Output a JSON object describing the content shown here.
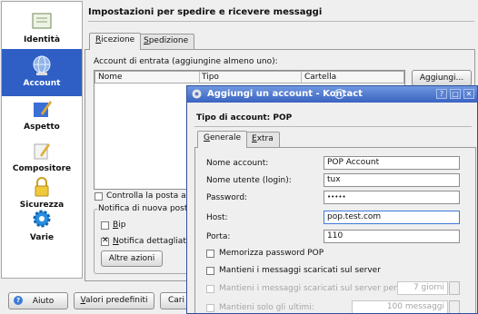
{
  "sidebar": {
    "items": [
      {
        "label": "Identità",
        "icon": "id-card-icon"
      },
      {
        "label": "Account",
        "icon": "globe-network-icon",
        "active": true
      },
      {
        "label": "Aspetto",
        "icon": "paintbrush-icon"
      },
      {
        "label": "Compositore",
        "icon": "pen-writing-icon"
      },
      {
        "label": "Sicurezza",
        "icon": "padlock-icon"
      },
      {
        "label": "Varie",
        "icon": "gear-icon"
      }
    ]
  },
  "main": {
    "title": "Impostazioni per spedire e ricevere messaggi",
    "tabs": [
      {
        "label_u": "R",
        "label_rest": "icezione"
      },
      {
        "label_u": "S",
        "label_rest": "pedizione"
      }
    ],
    "accounts_label": "Account di entrata (aggiungine almeno uno):",
    "columns": [
      "Nome",
      "Tipo",
      "Cartella"
    ],
    "add_button": "Aggiungi...",
    "check_mail": "Controlla la posta all'",
    "notify_group": "Notifica di nuova posta",
    "beep_u": "B",
    "beep_rest": "ip",
    "detailed_u": "N",
    "detailed_rest": "otifica dettagliata",
    "other_actions": "Altre azioni"
  },
  "footer": {
    "help": "Aiuto",
    "defaults_u": "V",
    "defaults_rest": "alori predefiniti",
    "load_partial": "Cari"
  },
  "dialog": {
    "title": "Aggiungi un account - Kontact",
    "heading": "Tipo di account: POP",
    "tabs": [
      {
        "label_u": "G",
        "label_rest": "enerale"
      },
      {
        "label_u": "E",
        "label_rest": "xtra"
      }
    ],
    "fields": [
      {
        "label": "Nome account:",
        "value": "POP Account"
      },
      {
        "label": "Nome utente (login):",
        "value": "tux"
      },
      {
        "label": "Password:",
        "value": "•••••"
      },
      {
        "label": "Host:",
        "value": "pop.test.com"
      },
      {
        "label": "Porta:",
        "value": "110"
      }
    ],
    "store_pw": "Memorizza password POP",
    "leave_on_server": "Mantieni i messaggi scaricati sul server",
    "keep_days": "Mantieni i messaggi scaricati sul server per",
    "keep_days_value": "7 giorni",
    "keep_last": "Mantieni solo gli ultimi:",
    "keep_last_value": "100 messaggi"
  },
  "colors": {
    "accent": "#2f5fc4",
    "titlebar": "#4a72c9"
  }
}
